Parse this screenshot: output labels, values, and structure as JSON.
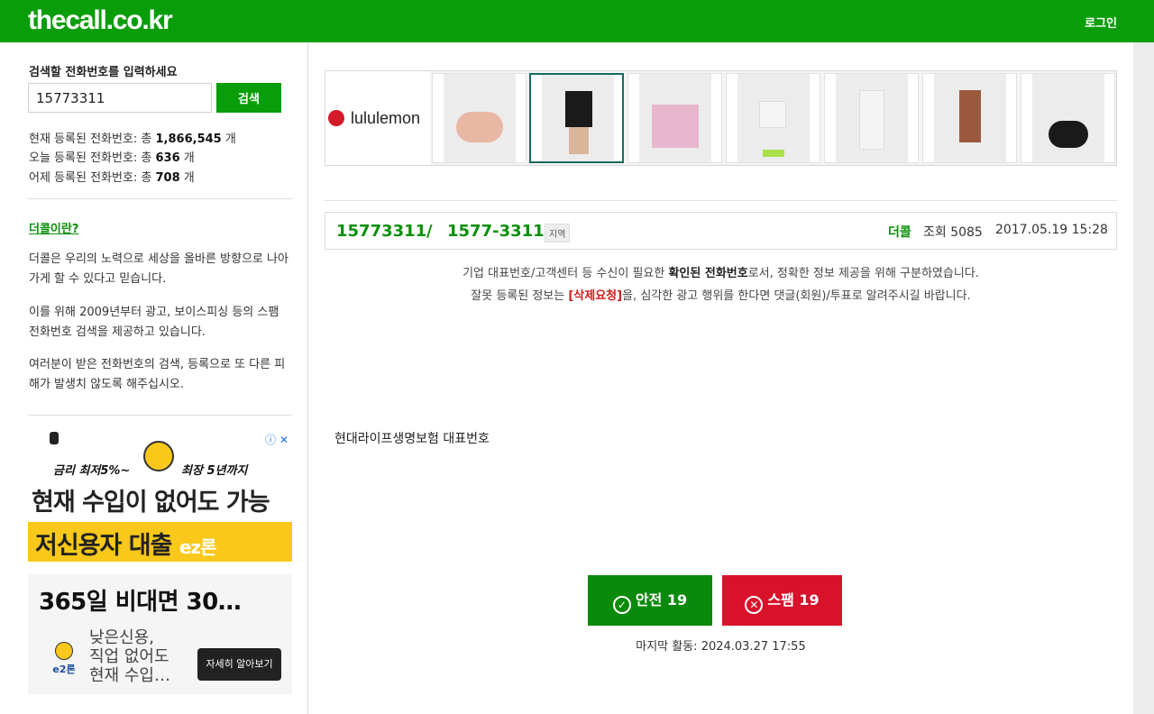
{
  "header": {
    "logo": "thecall.co.kr",
    "login_label": "로그인",
    "brand_color": "#0a9d0a"
  },
  "sidebar": {
    "search_title": "검색할 전화번호를 입력하세요",
    "search_value": "15773311",
    "search_button": "검색",
    "stats": [
      {
        "prefix": "현재 등록된 전화번호: 총 ",
        "value": "1,866,545",
        "suffix": " 개"
      },
      {
        "prefix": "오늘 등록된 전화번호: 총 ",
        "value": "636",
        "suffix": " 개"
      },
      {
        "prefix": "어제 등록된 전화번호: 총 ",
        "value": "708",
        "suffix": " 개"
      }
    ],
    "about_link": "더콜이란?",
    "paragraphs": [
      "더콜은 우리의 노력으로 세상을 올바른 방향으로 나아가게 할 수 있다고 믿습니다.",
      "이를 위해 2009년부터 광고, 보이스피싱 등의 스팸 전화번호 검색을 제공하고 있습니다.",
      "여러분이 받은 전화번호의 검색, 등록으로 또 다른 피해가 발생치 않도록 해주십시오."
    ],
    "ad": {
      "line1_left": "금리 최저5%~",
      "line1_right": "최장 5년까지",
      "line2": "현재 수입이 없어도 가능",
      "line3": "저신용자 대출",
      "line3_brand": "ez론",
      "card_title": "365일 비대면 30…",
      "card_desc": "낮은신용,\n직업 없어도\n현재 수입…",
      "card_logo": "e2론",
      "card_button": "자세히 알아보기"
    }
  },
  "top_ad": {
    "brand": "lululemon",
    "products": [
      "scrunchies",
      "black-skirt",
      "pink-tote",
      "white-skirt",
      "white-tank",
      "brown-dress",
      "black-bag"
    ]
  },
  "record": {
    "number_raw": "15773311",
    "separator": "/",
    "number_formatted": "1577-3311",
    "region_tag": "지역",
    "author": "더콜",
    "views": "조회 5085",
    "datetime": "2017.05.19 15:28"
  },
  "notice": {
    "line1_pre": "기업 대표번호/고객센터 등 수신이 필요한 ",
    "line1_bold": "확인된 전화번호",
    "line1_post": "로서, 정확한 정보 제공을 위해 구분하였습니다.",
    "line2_pre": "잘못 등록된 정보는 ",
    "line2_link": "[삭제요청]",
    "line2_post": "을, 심각한 광고 행위를 한다면 댓글(회원)/투표로 알려주시길 바랍니다."
  },
  "description": "현대라이프생명보험 대표번호",
  "votes": {
    "safe_label": "안전 19",
    "spam_label": "스팸 19",
    "safe_color": "#0a8a0a",
    "spam_color": "#d8122a"
  },
  "last_activity": "마지막 활동: 2024.03.27 17:55"
}
